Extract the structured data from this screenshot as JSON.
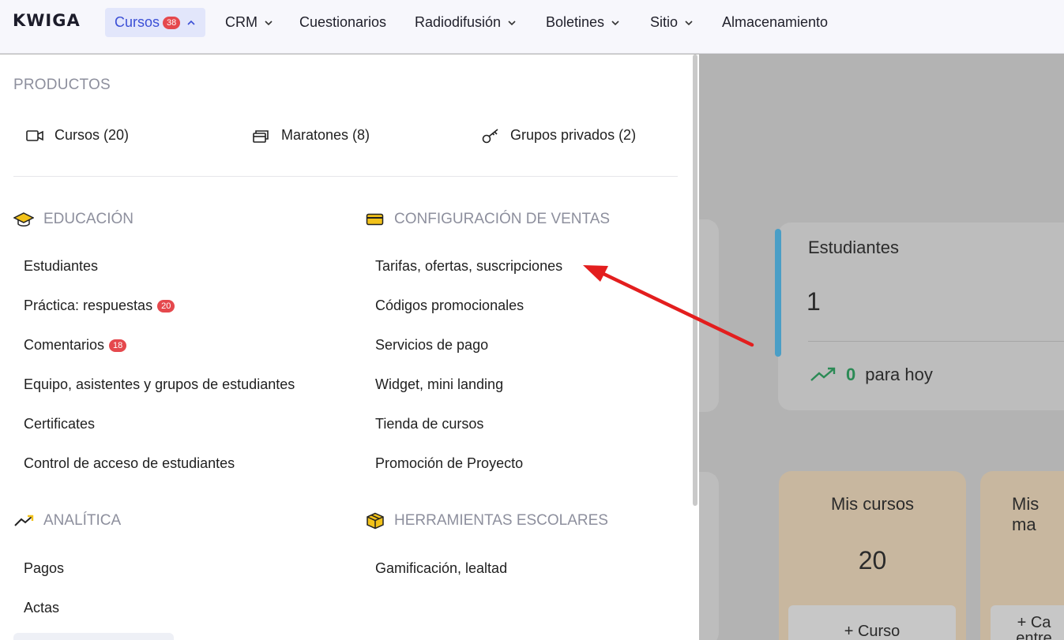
{
  "topbar": {
    "logo": "KWIGA",
    "nav": [
      {
        "label": "Cursos",
        "badge": "38",
        "active": true
      },
      {
        "label": "CRM"
      },
      {
        "label": "Cuestionarios"
      },
      {
        "label": "Radiodifusión"
      },
      {
        "label": "Boletines"
      },
      {
        "label": "Sitio"
      },
      {
        "label": "Almacenamiento"
      }
    ]
  },
  "menu": {
    "products_title": "PRODUCTOS",
    "products": [
      {
        "label": "Cursos (20)",
        "icon": "video-camera-icon"
      },
      {
        "label": "Maratones (8)",
        "icon": "cards-stack-icon"
      },
      {
        "label": "Grupos privados (2)",
        "icon": "key-icon"
      }
    ],
    "education": {
      "title": "EDUCACIÓN",
      "icon": "graduation-cap-icon",
      "items": [
        {
          "label": "Estudiantes"
        },
        {
          "label": "Práctica: respuestas",
          "badge": "20"
        },
        {
          "label": "Comentarios",
          "badge": "18"
        },
        {
          "label": "Equipo, asistentes y grupos de estudiantes"
        },
        {
          "label": "Certificates"
        },
        {
          "label": "Control de acceso de estudiantes"
        }
      ]
    },
    "sales": {
      "title": "CONFIGURACIÓN DE VENTAS",
      "icon": "credit-card-icon",
      "items": [
        {
          "label": "Tarifas, ofertas, suscripciones"
        },
        {
          "label": "Códigos promocionales"
        },
        {
          "label": "Servicios de pago"
        },
        {
          "label": "Widget, mini landing"
        },
        {
          "label": "Tienda de cursos"
        },
        {
          "label": "Promoción de Proyecto"
        }
      ]
    },
    "analytics": {
      "title": "ANALÍTICA",
      "icon": "trend-up-icon",
      "items": [
        {
          "label": "Pagos"
        },
        {
          "label": "Actas"
        }
      ]
    },
    "tools": {
      "title": "HERRAMIENTAS ESCOLARES",
      "icon": "box-icon",
      "items": [
        {
          "label": "Gamificación, lealtad"
        }
      ]
    }
  },
  "dashboard": {
    "students_title": "Estudiantes",
    "students_value": "1",
    "today_value": "0",
    "today_label": "para hoy",
    "my_courses_title": "Mis cursos",
    "my_courses_value": "20",
    "add_course_label": "+ Curso",
    "marathons_title_partial": "Mis ma",
    "marathons_btn_line1": "+ Ca",
    "marathons_btn_line2": "entre"
  },
  "colors": {
    "accent": "#3b4fd6",
    "badge": "#e5484d",
    "arrow": "#e31e1e",
    "students_bar": "#4a9ec6",
    "positive": "#2b8a55"
  }
}
